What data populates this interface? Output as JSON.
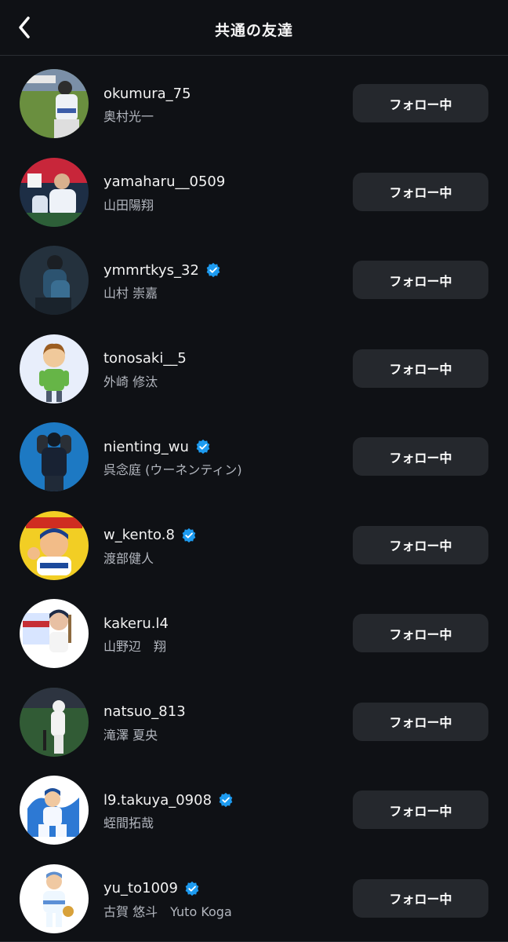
{
  "header": {
    "title": "共通の友達"
  },
  "users": [
    {
      "username": "okumura_75",
      "name": "奥村光一",
      "verified": false,
      "button": "フォロー中"
    },
    {
      "username": "yamaharu__0509",
      "name": "山田陽翔",
      "verified": false,
      "button": "フォロー中"
    },
    {
      "username": "ymmrtkys_32",
      "name": "山村 崇嘉",
      "verified": true,
      "button": "フォロー中"
    },
    {
      "username": "tonosaki__5",
      "name": "外崎 修汰",
      "verified": false,
      "button": "フォロー中"
    },
    {
      "username": "nienting_wu",
      "name": "呉念庭 (ウーネンティン)",
      "verified": true,
      "button": "フォロー中"
    },
    {
      "username": "w_kento.8",
      "name": "渡部健人",
      "verified": true,
      "button": "フォロー中"
    },
    {
      "username": "kakeru.l4",
      "name": "山野辺　翔",
      "verified": false,
      "button": "フォロー中"
    },
    {
      "username": "natsuo_813",
      "name": "滝澤 夏央",
      "verified": false,
      "button": "フォロー中"
    },
    {
      "username": "l9.takuya_0908",
      "name": "蛭間拓哉",
      "verified": true,
      "button": "フォロー中"
    },
    {
      "username": "yu_to1009",
      "name": "古賀 悠斗　Yuto Koga",
      "verified": true,
      "button": "フォロー中"
    }
  ],
  "icons": {
    "back": "chevron-left-icon",
    "verified": "verified-badge-icon",
    "avatar": "avatar-image"
  },
  "colors": {
    "background": "#0f1115",
    "button_background": "#25282d",
    "verified": "#1d9bf0",
    "secondary_text": "#b3b7bf"
  }
}
